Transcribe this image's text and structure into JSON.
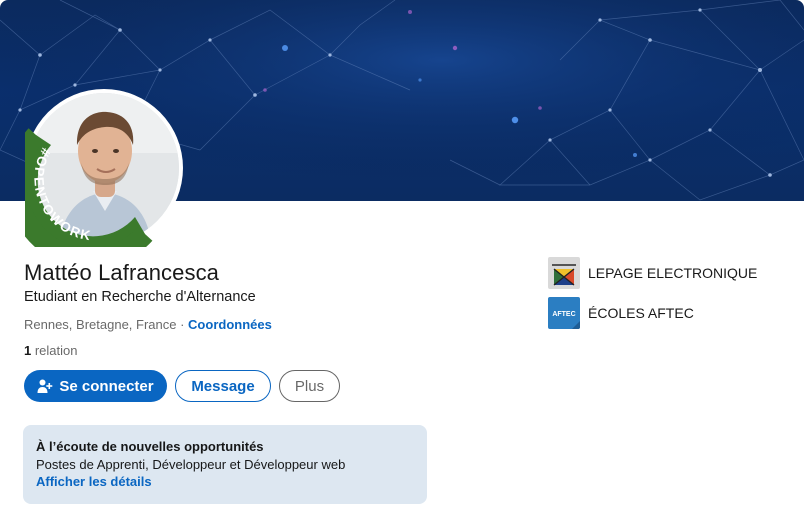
{
  "profile": {
    "name": "Mattéo Lafrancesca",
    "headline": "Etudiant en Recherche d'Alternance",
    "location": "Rennes, Bretagne, France",
    "separator": " · ",
    "contact_link": "Coordonnées",
    "relations_count": "1",
    "relations_label": " relation",
    "badge_text": "#OPENTOWORK"
  },
  "actions": {
    "connect_label": "Se connecter",
    "message_label": "Message",
    "more_label": "Plus"
  },
  "open_to_work": {
    "title": "À l’écoute de nouvelles opportunités",
    "roles": "Postes de Apprenti, Développeur et Développeur web",
    "details_link": "Afficher les détails"
  },
  "organizations": [
    {
      "name": "LEPAGE ELECTRONIQUE",
      "logo": "lepage-logo"
    },
    {
      "name": "ÉCOLES AFTEC",
      "logo": "aftec-logo",
      "logo_text": "AFTEC"
    }
  ],
  "colors": {
    "primary": "#0a66c2",
    "open_to_work_green": "#3b7a2c",
    "banner": "#0a2f6d",
    "opp_background": "#dde7f1"
  }
}
